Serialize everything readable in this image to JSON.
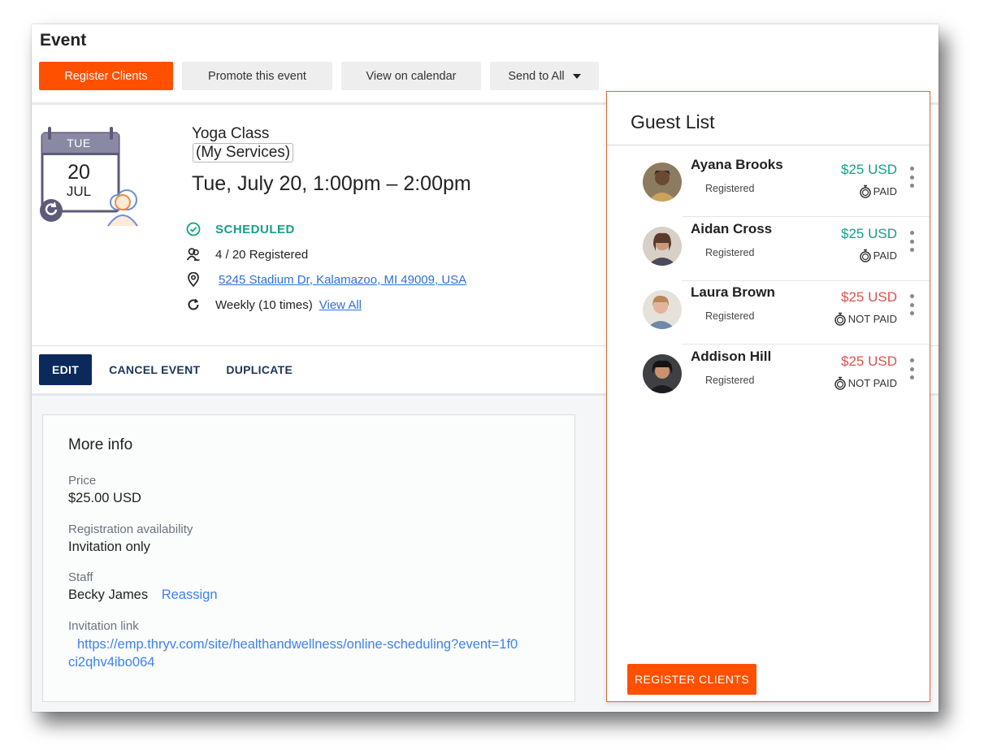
{
  "page": {
    "title": "Event"
  },
  "toolbar": {
    "register_clients": "Register Clients",
    "promote": "Promote this event",
    "view_calendar": "View on calendar",
    "send_to_all": "Send to All"
  },
  "calendar_icon": {
    "day": "TUE",
    "date": "20",
    "month": "JUL"
  },
  "event": {
    "name": "Yoga Class",
    "category": "(My Services)",
    "when": "Tue, July 20, 1:00pm – 2:00pm",
    "status": "SCHEDULED",
    "registered": "4 / 20 Registered",
    "address": "5245 Stadium Dr, Kalamazoo, MI 49009, USA",
    "recurrence": "Weekly (10 times)",
    "view_all": "View All"
  },
  "actions": {
    "edit": "EDIT",
    "cancel": "CANCEL EVENT",
    "duplicate": "DUPLICATE"
  },
  "more_info": {
    "title": "More info",
    "price_label": "Price",
    "price_value": "$25.00 USD",
    "availability_label": "Registration availability",
    "availability_value": "Invitation only",
    "staff_label": "Staff",
    "staff_value": "Becky James",
    "reassign": "Reassign",
    "invitation_label": "Invitation link",
    "invitation_url": "https://emp.thryv.com/site/healthandwellness/online-scheduling?event=1f0ci2qhv4ibo064"
  },
  "guest_list": {
    "title": "Guest List",
    "register_button": "REGISTER CLIENTS",
    "guests": [
      {
        "name": "Ayana Brooks",
        "status": "Registered",
        "price": "$25 USD",
        "payment": "PAID"
      },
      {
        "name": "Aidan Cross",
        "status": "Registered",
        "price": "$25 USD",
        "payment": "PAID"
      },
      {
        "name": "Laura Brown",
        "status": "Registered",
        "price": "$25 USD",
        "payment": "NOT PAID"
      },
      {
        "name": "Addison Hill",
        "status": "Registered",
        "price": "$25 USD",
        "payment": "NOT PAID"
      }
    ]
  },
  "colors": {
    "accent": "#ff5000",
    "navy": "#0b2a5b",
    "paid": "#16a085",
    "not_paid": "#d9534f",
    "link": "#3b82f6"
  }
}
